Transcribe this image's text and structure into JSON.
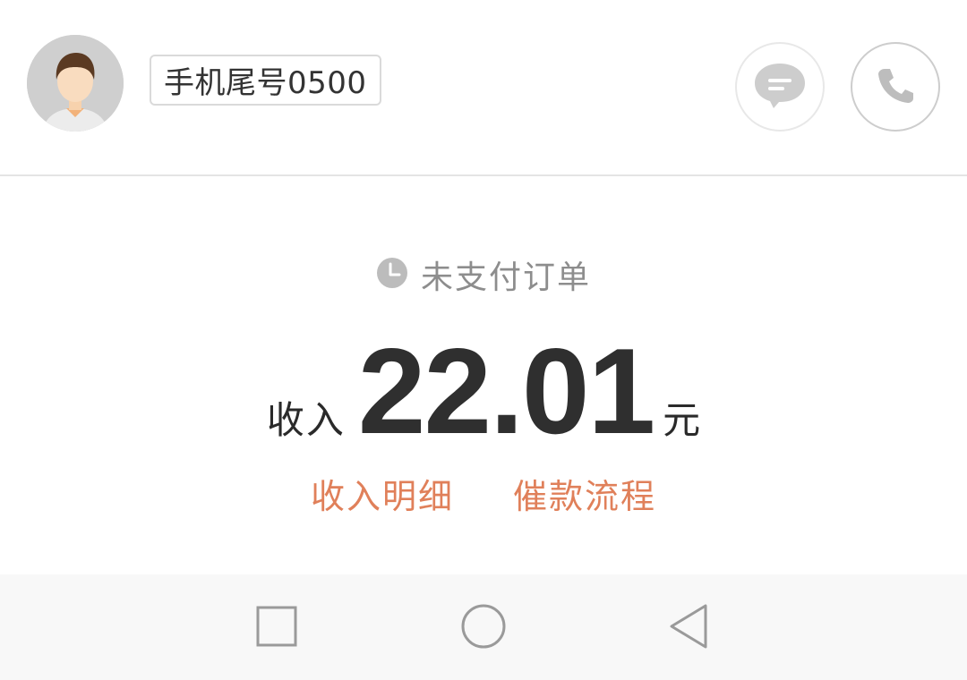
{
  "header": {
    "avatar_icon": "user-avatar-icon",
    "phone_tag": "手机尾号0500",
    "message_icon": "chat-bubble-icon",
    "call_icon": "phone-icon"
  },
  "order": {
    "status_icon": "clock-icon",
    "status_text": "未支付订单",
    "income_prefix": "收入",
    "amount": "22.01",
    "unit": "元"
  },
  "links": {
    "income_detail": "收入明细",
    "collection_process": "催款流程"
  },
  "navbar": {
    "recent_icon": "square-recent-apps-icon",
    "home_icon": "circle-home-icon",
    "back_icon": "triangle-back-icon"
  },
  "colors": {
    "accent": "#e0805a",
    "text_dark": "#2f2f2f",
    "text_muted": "#8d8d8d"
  }
}
